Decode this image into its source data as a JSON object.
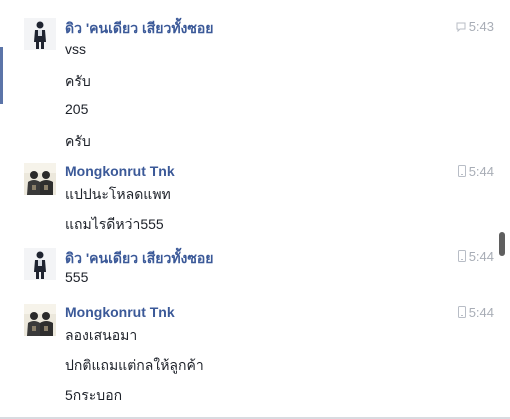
{
  "conversation": {
    "groups": [
      {
        "sender": "ดิว 'คนเดียว เสียวทั้งซอย",
        "time": "5:43",
        "device_icon": "chat-bubble-icon",
        "avatar": "standing-person-avatar",
        "messages": [
          "vss",
          "ครับ",
          "205",
          "ครับ"
        ]
      },
      {
        "sender": "Mongkonrut Tnk",
        "time": "5:44",
        "device_icon": "mobile-phone-icon",
        "avatar": "two-people-avatar",
        "messages": [
          "แปปนะโหลดแพท",
          "แถมไรดีหว่า555"
        ]
      },
      {
        "sender": "ดิว 'คนเดียว เสียวทั้งซอย",
        "time": "5:44",
        "device_icon": "mobile-phone-icon",
        "avatar": "standing-person-avatar",
        "messages": [
          "555"
        ]
      },
      {
        "sender": "Mongkonrut Tnk",
        "time": "5:44",
        "device_icon": "mobile-phone-icon",
        "avatar": "two-people-avatar",
        "messages": [
          "ลองเสนอมา",
          "ปกติแถมแต่กลให้ลูกค้า",
          "5กระบอก"
        ]
      }
    ]
  },
  "colors": {
    "sender_name": "#3b5998",
    "message_text": "#1d2129",
    "timestamp": "#a8adb6",
    "active_indicator": "#5b74a8"
  }
}
